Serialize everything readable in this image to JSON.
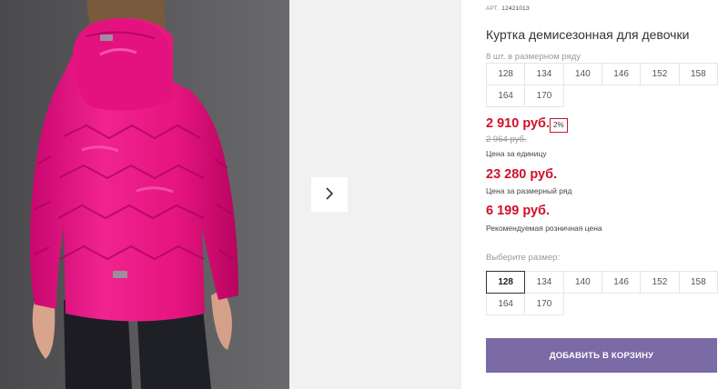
{
  "product": {
    "article_label": "АРТ.",
    "article": "12421013",
    "title": "Куртка демисезонная для девочки",
    "row_label": "8 шт. в размерном ряду",
    "row_sizes": [
      "128",
      "134",
      "140",
      "146",
      "152",
      "158",
      "164",
      "170"
    ]
  },
  "pricing": {
    "price": "2 910 руб.",
    "discount": "2%",
    "old_price": "2 964 руб.",
    "unit_note": "Цена за единицу",
    "row_price": "23 280 руб.",
    "row_note": "Цена за размерный ряд",
    "rrp": "6 199 руб.",
    "rrp_note": "Рекомендуемая розничная цена",
    "accent_color": "#d0112b"
  },
  "size_picker": {
    "label": "Выберите размер:",
    "sizes": [
      "128",
      "134",
      "140",
      "146",
      "152",
      "158",
      "164",
      "170"
    ],
    "selected": "128"
  },
  "cart": {
    "add_label": "ДОБАВИТЬ В КОРЗИНУ",
    "button_color": "#7a6aa6"
  },
  "gallery": {
    "next_icon": "chevron-right-icon",
    "jacket_color": "#ec1a8a"
  }
}
